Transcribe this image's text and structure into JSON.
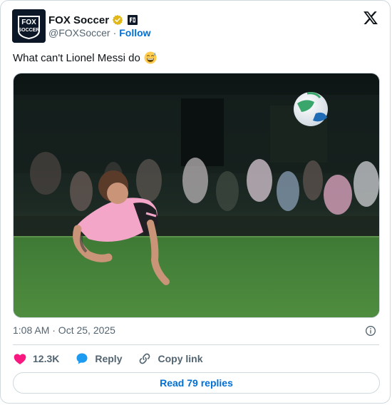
{
  "tweet": {
    "author": {
      "display_name": "FOX Soccer",
      "handle": "@FOXSoccer",
      "separator": "·",
      "follow_label": "Follow",
      "avatar_logo_top": "FOX",
      "avatar_logo_bottom": "SOCCER",
      "verified_icon": "gold-verified-badge",
      "affiliate_icon": "fox-sports-affiliate-badge"
    },
    "text": "What can't Lionel Messi do",
    "emoji": "😅",
    "media": {
      "alt": "Lionel Messi diving header in pink jersey with ball in the air"
    },
    "timestamp": "1:08 AM · Oct 25, 2025",
    "stats": {
      "likes": "12.3K",
      "reply_label": "Reply",
      "copy_link_label": "Copy link"
    },
    "read_replies_label": "Read 79 replies"
  },
  "colors": {
    "link": "#006fd6",
    "like": "#f91880",
    "reply": "#1d9bf0",
    "border": "#cfd9de",
    "muted": "#536471",
    "verified": "#e2b719"
  }
}
